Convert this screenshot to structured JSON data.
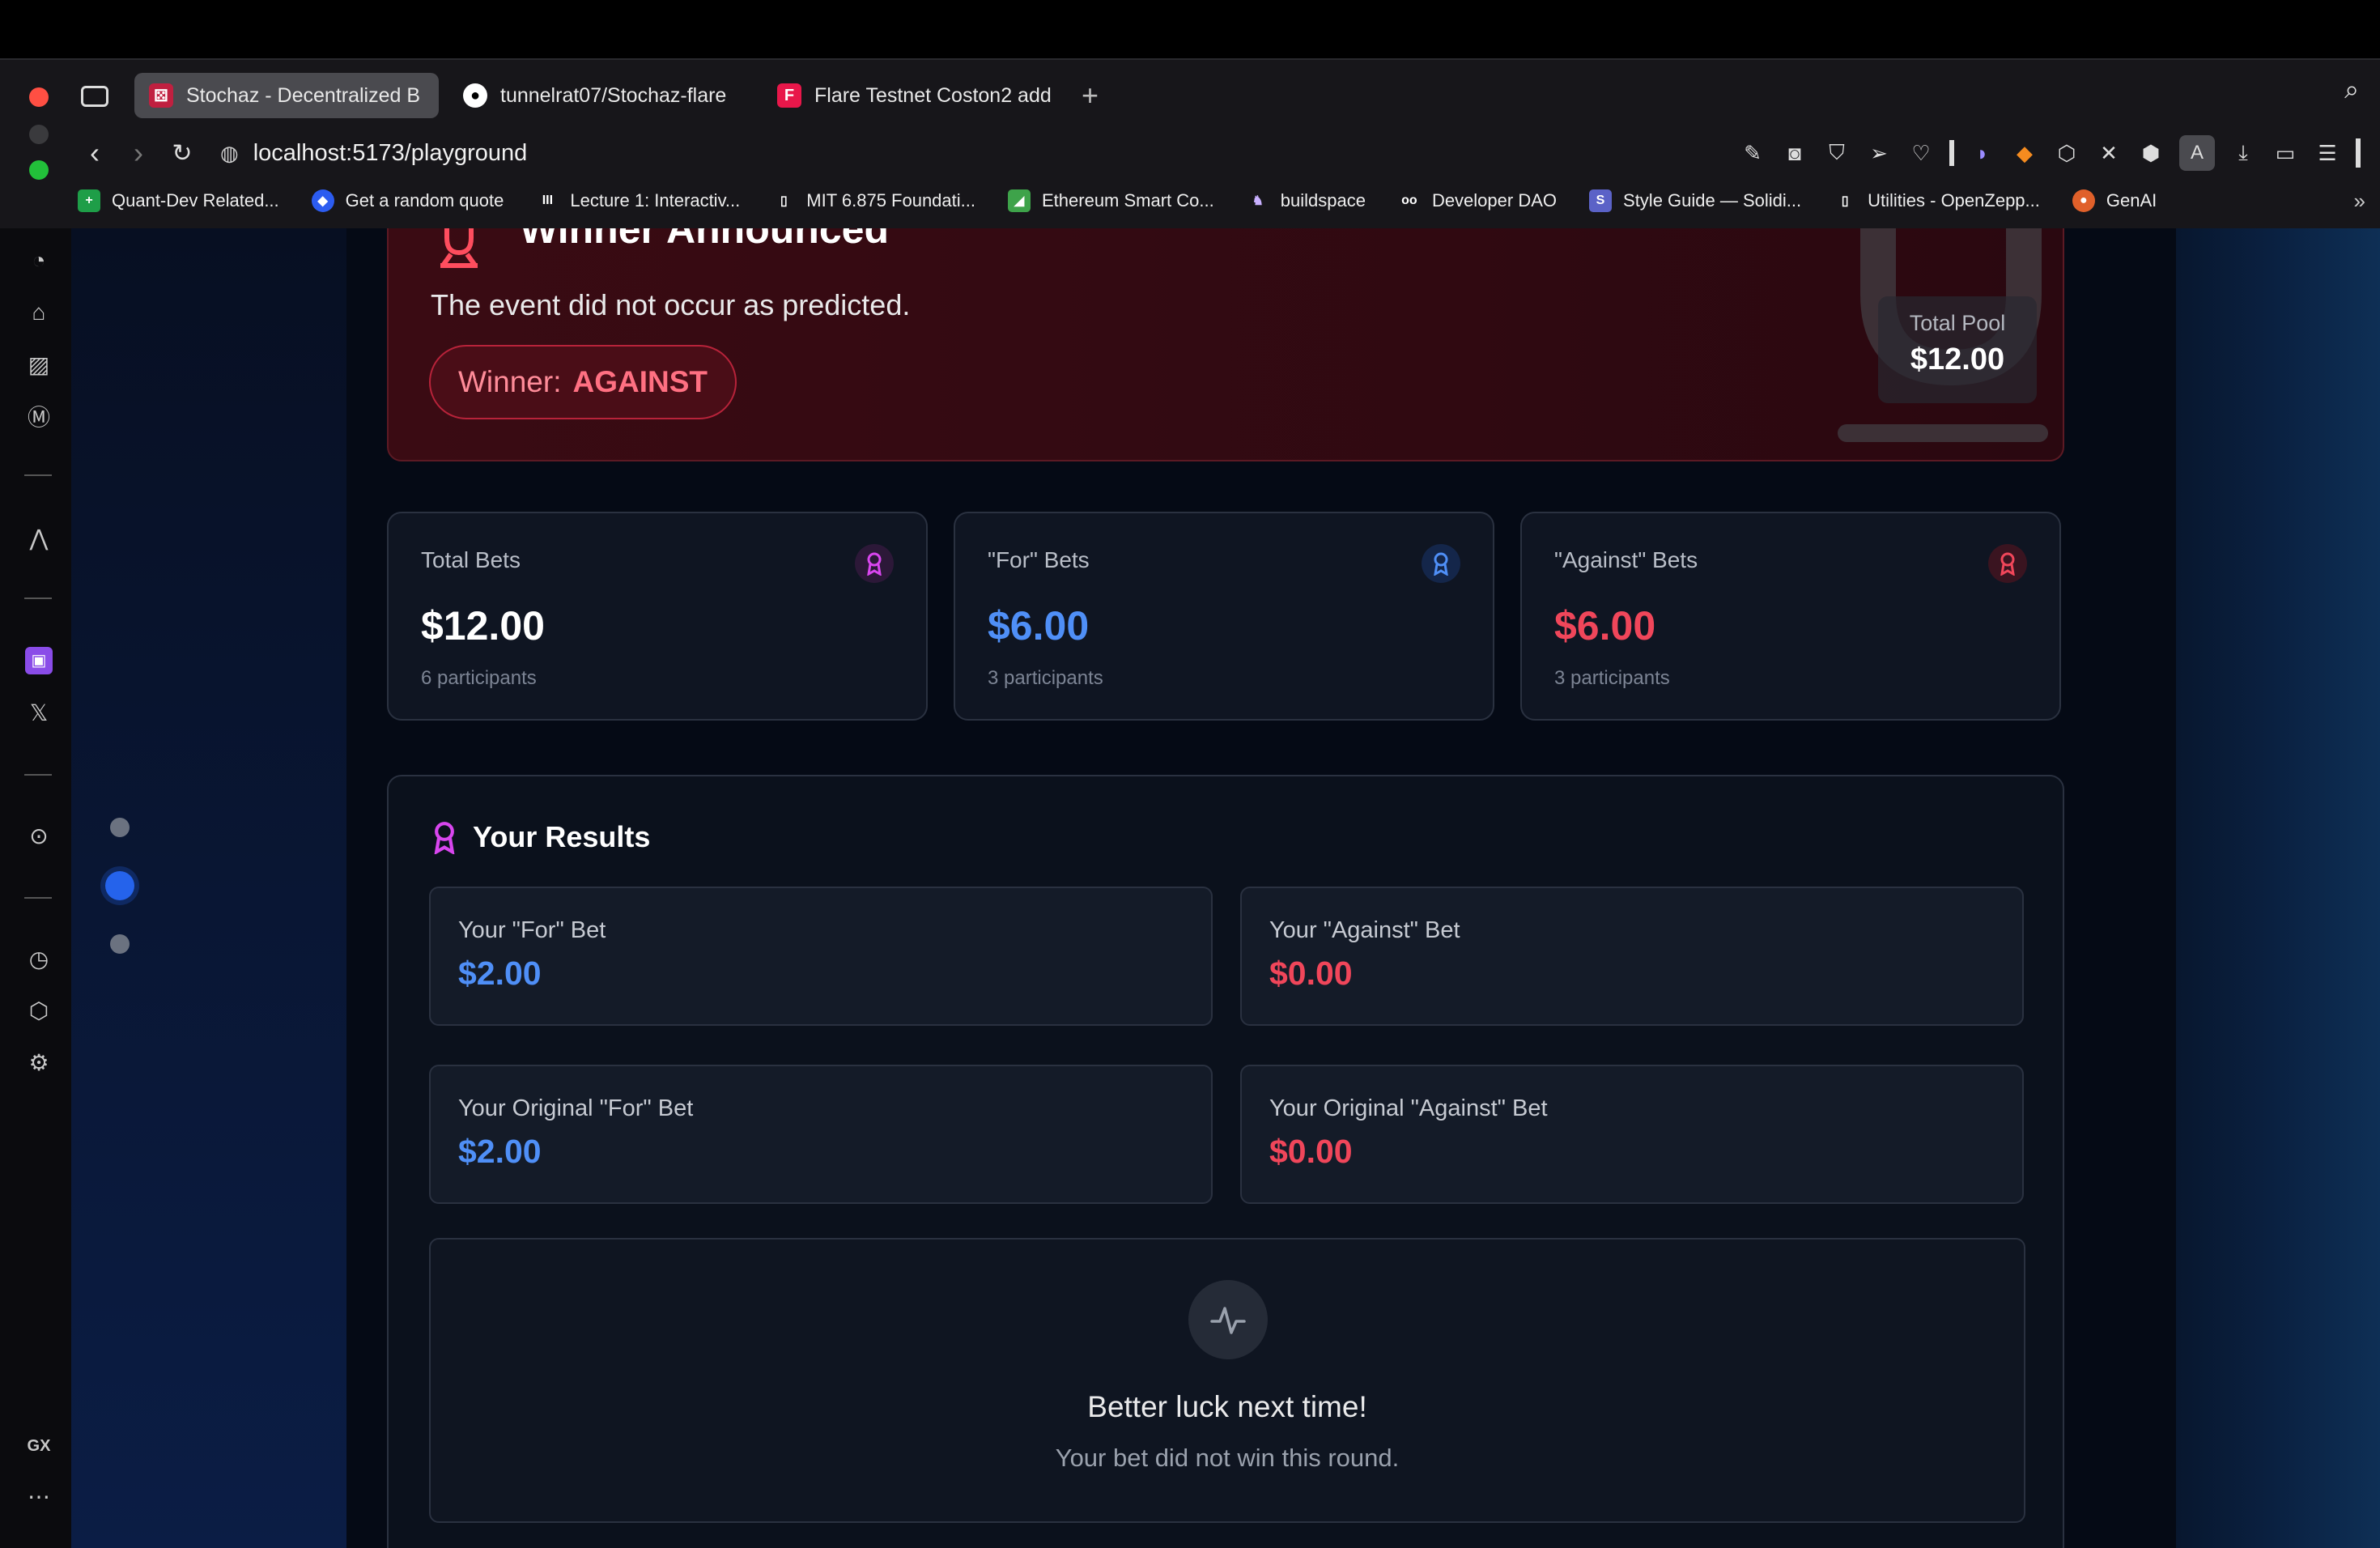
{
  "browser": {
    "tabs": [
      {
        "label": "Stochaz - Decentralized B",
        "active": true,
        "icon": "dice-icon"
      },
      {
        "label": "tunnelrat07/Stochaz-flare",
        "active": false,
        "icon": "github-icon"
      },
      {
        "label": "Flare Testnet Coston2 add",
        "active": false,
        "icon": "flare-icon"
      }
    ],
    "url": "localhost:5173/playground",
    "bookmarks": [
      {
        "label": "Quant-Dev Related...",
        "color": "#1e9e48"
      },
      {
        "label": "Get a random quote",
        "color": "#2c5cf0"
      },
      {
        "label": "Lecture 1: Interactiv...",
        "color": "#333333"
      },
      {
        "label": "MIT 6.875 Foundati...",
        "color": "#333333"
      },
      {
        "label": "Ethereum Smart Co...",
        "color": "#3ea34a"
      },
      {
        "label": "buildspace",
        "color": "#7a4dd8"
      },
      {
        "label": "Developer DAO",
        "color": "#222222"
      },
      {
        "label": "Style Guide — Solidi...",
        "color": "#5b62c7"
      },
      {
        "label": "Utilities - OpenZepp...",
        "color": "#333333"
      },
      {
        "label": "GenAI",
        "color": "#e0602a"
      }
    ],
    "sidebar_bottom_label": "GX",
    "profile_initial": "A"
  },
  "winner": {
    "title": "Winner Announced",
    "description": "The event did not occur as predicted.",
    "badge_prefix": "Winner:",
    "badge_value": "AGAINST",
    "pool_label": "Total Pool",
    "pool_value": "$12.00"
  },
  "stats": [
    {
      "label": "Total Bets",
      "value": "$12.00",
      "sub": "6 participants",
      "color": "#ffffff",
      "icon_color": "#d946ef"
    },
    {
      "label": "\"For\" Bets",
      "value": "$6.00",
      "sub": "3 participants",
      "color": "#4f8ff7",
      "icon_color": "#4f8ff7"
    },
    {
      "label": "\"Against\" Bets",
      "value": "$6.00",
      "sub": "3 participants",
      "color": "#f0465a",
      "icon_color": "#f0465a"
    }
  ],
  "results": {
    "title": "Your Results",
    "cards": [
      {
        "label": "Your \"For\" Bet",
        "value": "$2.00",
        "color": "#4f8ff7"
      },
      {
        "label": "Your \"Against\" Bet",
        "value": "$0.00",
        "color": "#f0465a"
      },
      {
        "label": "Your Original \"For\" Bet",
        "value": "$2.00",
        "color": "#4f8ff7"
      },
      {
        "label": "Your Original \"Against\" Bet",
        "value": "$0.00",
        "color": "#f0465a"
      }
    ],
    "message_title": "Better luck next time!",
    "message_sub": "Your bet did not win this round."
  },
  "pager": {
    "count": 3,
    "active_index": 1
  }
}
